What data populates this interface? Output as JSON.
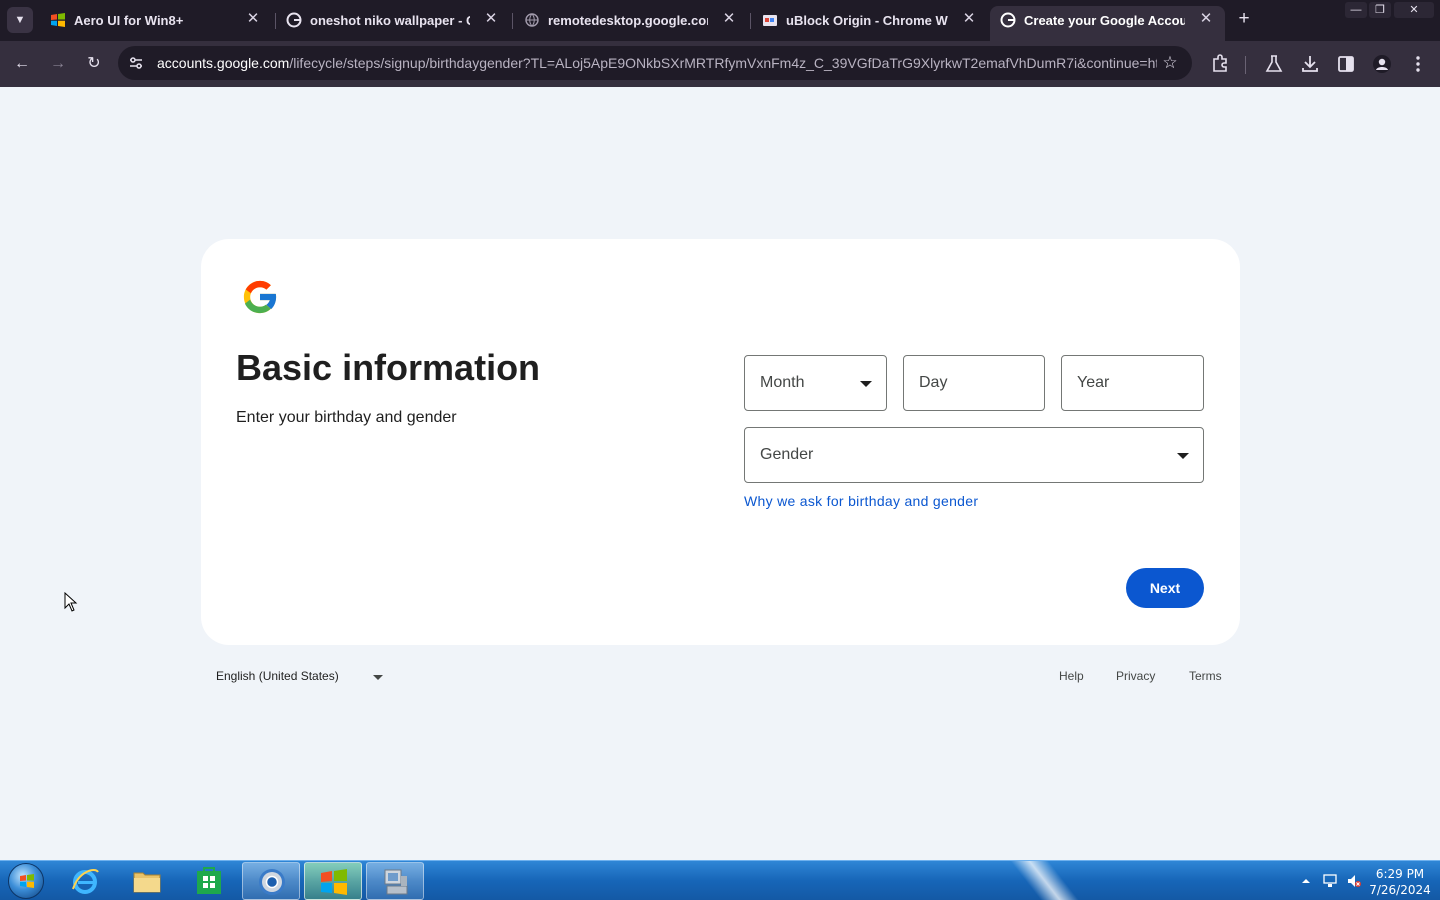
{
  "browser": {
    "tabs": [
      {
        "title": "Aero UI for Win8+",
        "icon": "windows-flag-icon",
        "active": false
      },
      {
        "title": "oneshot niko wallpaper - Google Search",
        "icon": "google-g-icon",
        "active": false
      },
      {
        "title": "remotedesktop.google.com",
        "icon": "globe-icon",
        "active": false
      },
      {
        "title": "uBlock Origin - Chrome Web Store",
        "icon": "webstore-icon",
        "active": false
      },
      {
        "title": "Create your Google Account",
        "icon": "google-g-icon",
        "active": true
      }
    ],
    "url_host": "accounts.google.com",
    "url_path": "/lifecycle/steps/signup/birthdaygender?TL=ALoj5ApE9ONkbSXrMRTRfymVxnFm4z_C_39VGfDaTrG9XlyrkwT2emafVhDumR7i&continue=htt..."
  },
  "signup": {
    "heading": "Basic information",
    "subheading": "Enter your birthday and gender",
    "month_placeholder": "Month",
    "day_placeholder": "Day",
    "year_placeholder": "Year",
    "gender_placeholder": "Gender",
    "why_link": "Why we ask for birthday and gender",
    "next_label": "Next"
  },
  "footer": {
    "language": "English (United States)",
    "help": "Help",
    "privacy": "Privacy",
    "terms": "Terms"
  },
  "taskbar": {
    "time": "6:29 PM",
    "date": "7/26/2024"
  },
  "colors": {
    "accent_blue": "#0b57d0",
    "page_background": "#f0f4f9",
    "browser_frame": "#1f1b27"
  }
}
